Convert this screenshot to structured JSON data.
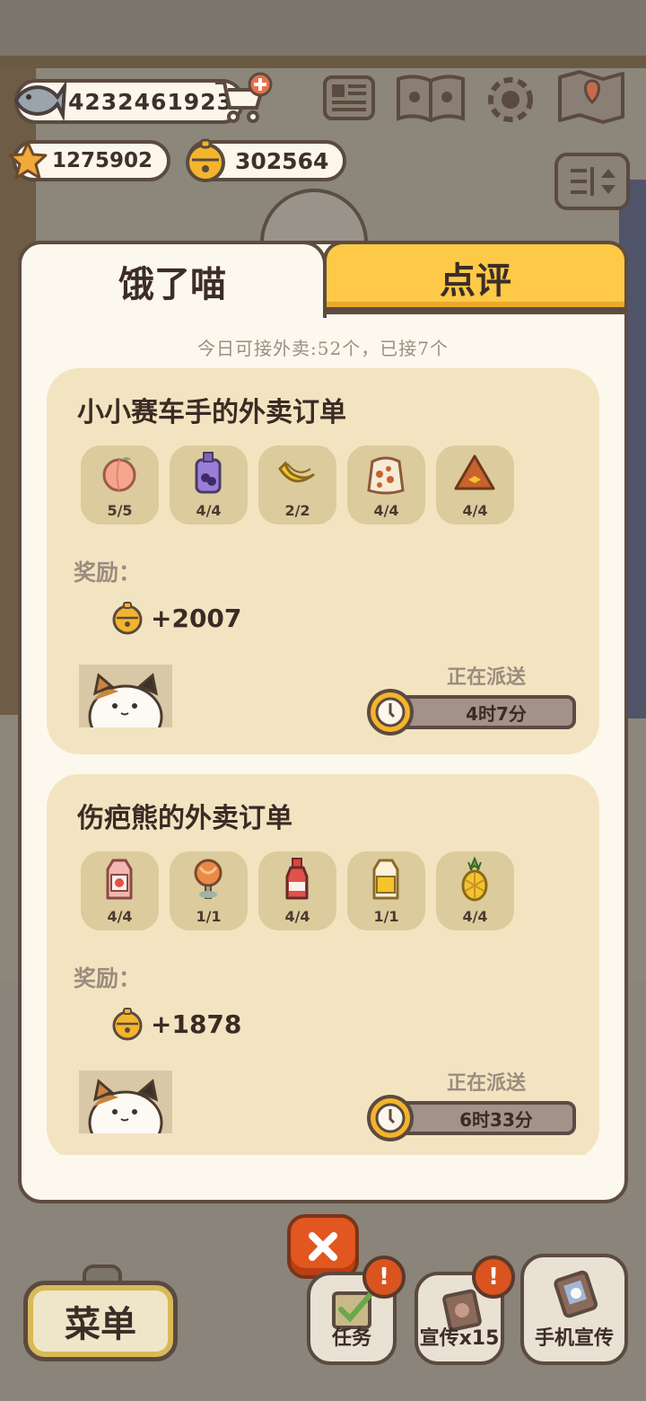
{
  "currencies": {
    "fish": "4232461923",
    "stars": "1275902",
    "bells": "302564"
  },
  "tabs": {
    "hungry": "饿了喵",
    "review": "点评"
  },
  "daily_note": "今日可接外卖:52个，已接7个",
  "orders": [
    {
      "title": "小小赛车手的外卖订单",
      "items": [
        {
          "icon": "peach-icon",
          "count": "5/5"
        },
        {
          "icon": "grape-juice-icon",
          "count": "4/4"
        },
        {
          "icon": "banana-icon",
          "count": "2/2"
        },
        {
          "icon": "snack-bag-icon",
          "count": "4/4"
        },
        {
          "icon": "nacho-chip-icon",
          "count": "4/4"
        }
      ],
      "reward_label": "奖励：",
      "reward_value": "+2007",
      "status": "正在派送",
      "timer": "4时7分"
    },
    {
      "title": "伤疤熊的外卖订单",
      "items": [
        {
          "icon": "strawberry-milk-icon",
          "count": "4/4"
        },
        {
          "icon": "lollipop-icon",
          "count": "1/1"
        },
        {
          "icon": "soda-bottle-icon",
          "count": "4/4"
        },
        {
          "icon": "juice-carton-icon",
          "count": "1/1"
        },
        {
          "icon": "pineapple-icon",
          "count": "4/4"
        }
      ],
      "reward_label": "奖励：",
      "reward_value": "+1878",
      "status": "正在派送",
      "timer": "6时33分"
    }
  ],
  "bottom": {
    "menu": "菜单",
    "task": "任务",
    "promo": "宣传x15",
    "phone_promo": "手机宣传"
  },
  "colors": {
    "panel": "#fdf8ee",
    "card": "#f3e4c1",
    "tab_active_yellow": "#fdc947",
    "close_orange": "#e2561f",
    "outline": "#5e4c41"
  }
}
